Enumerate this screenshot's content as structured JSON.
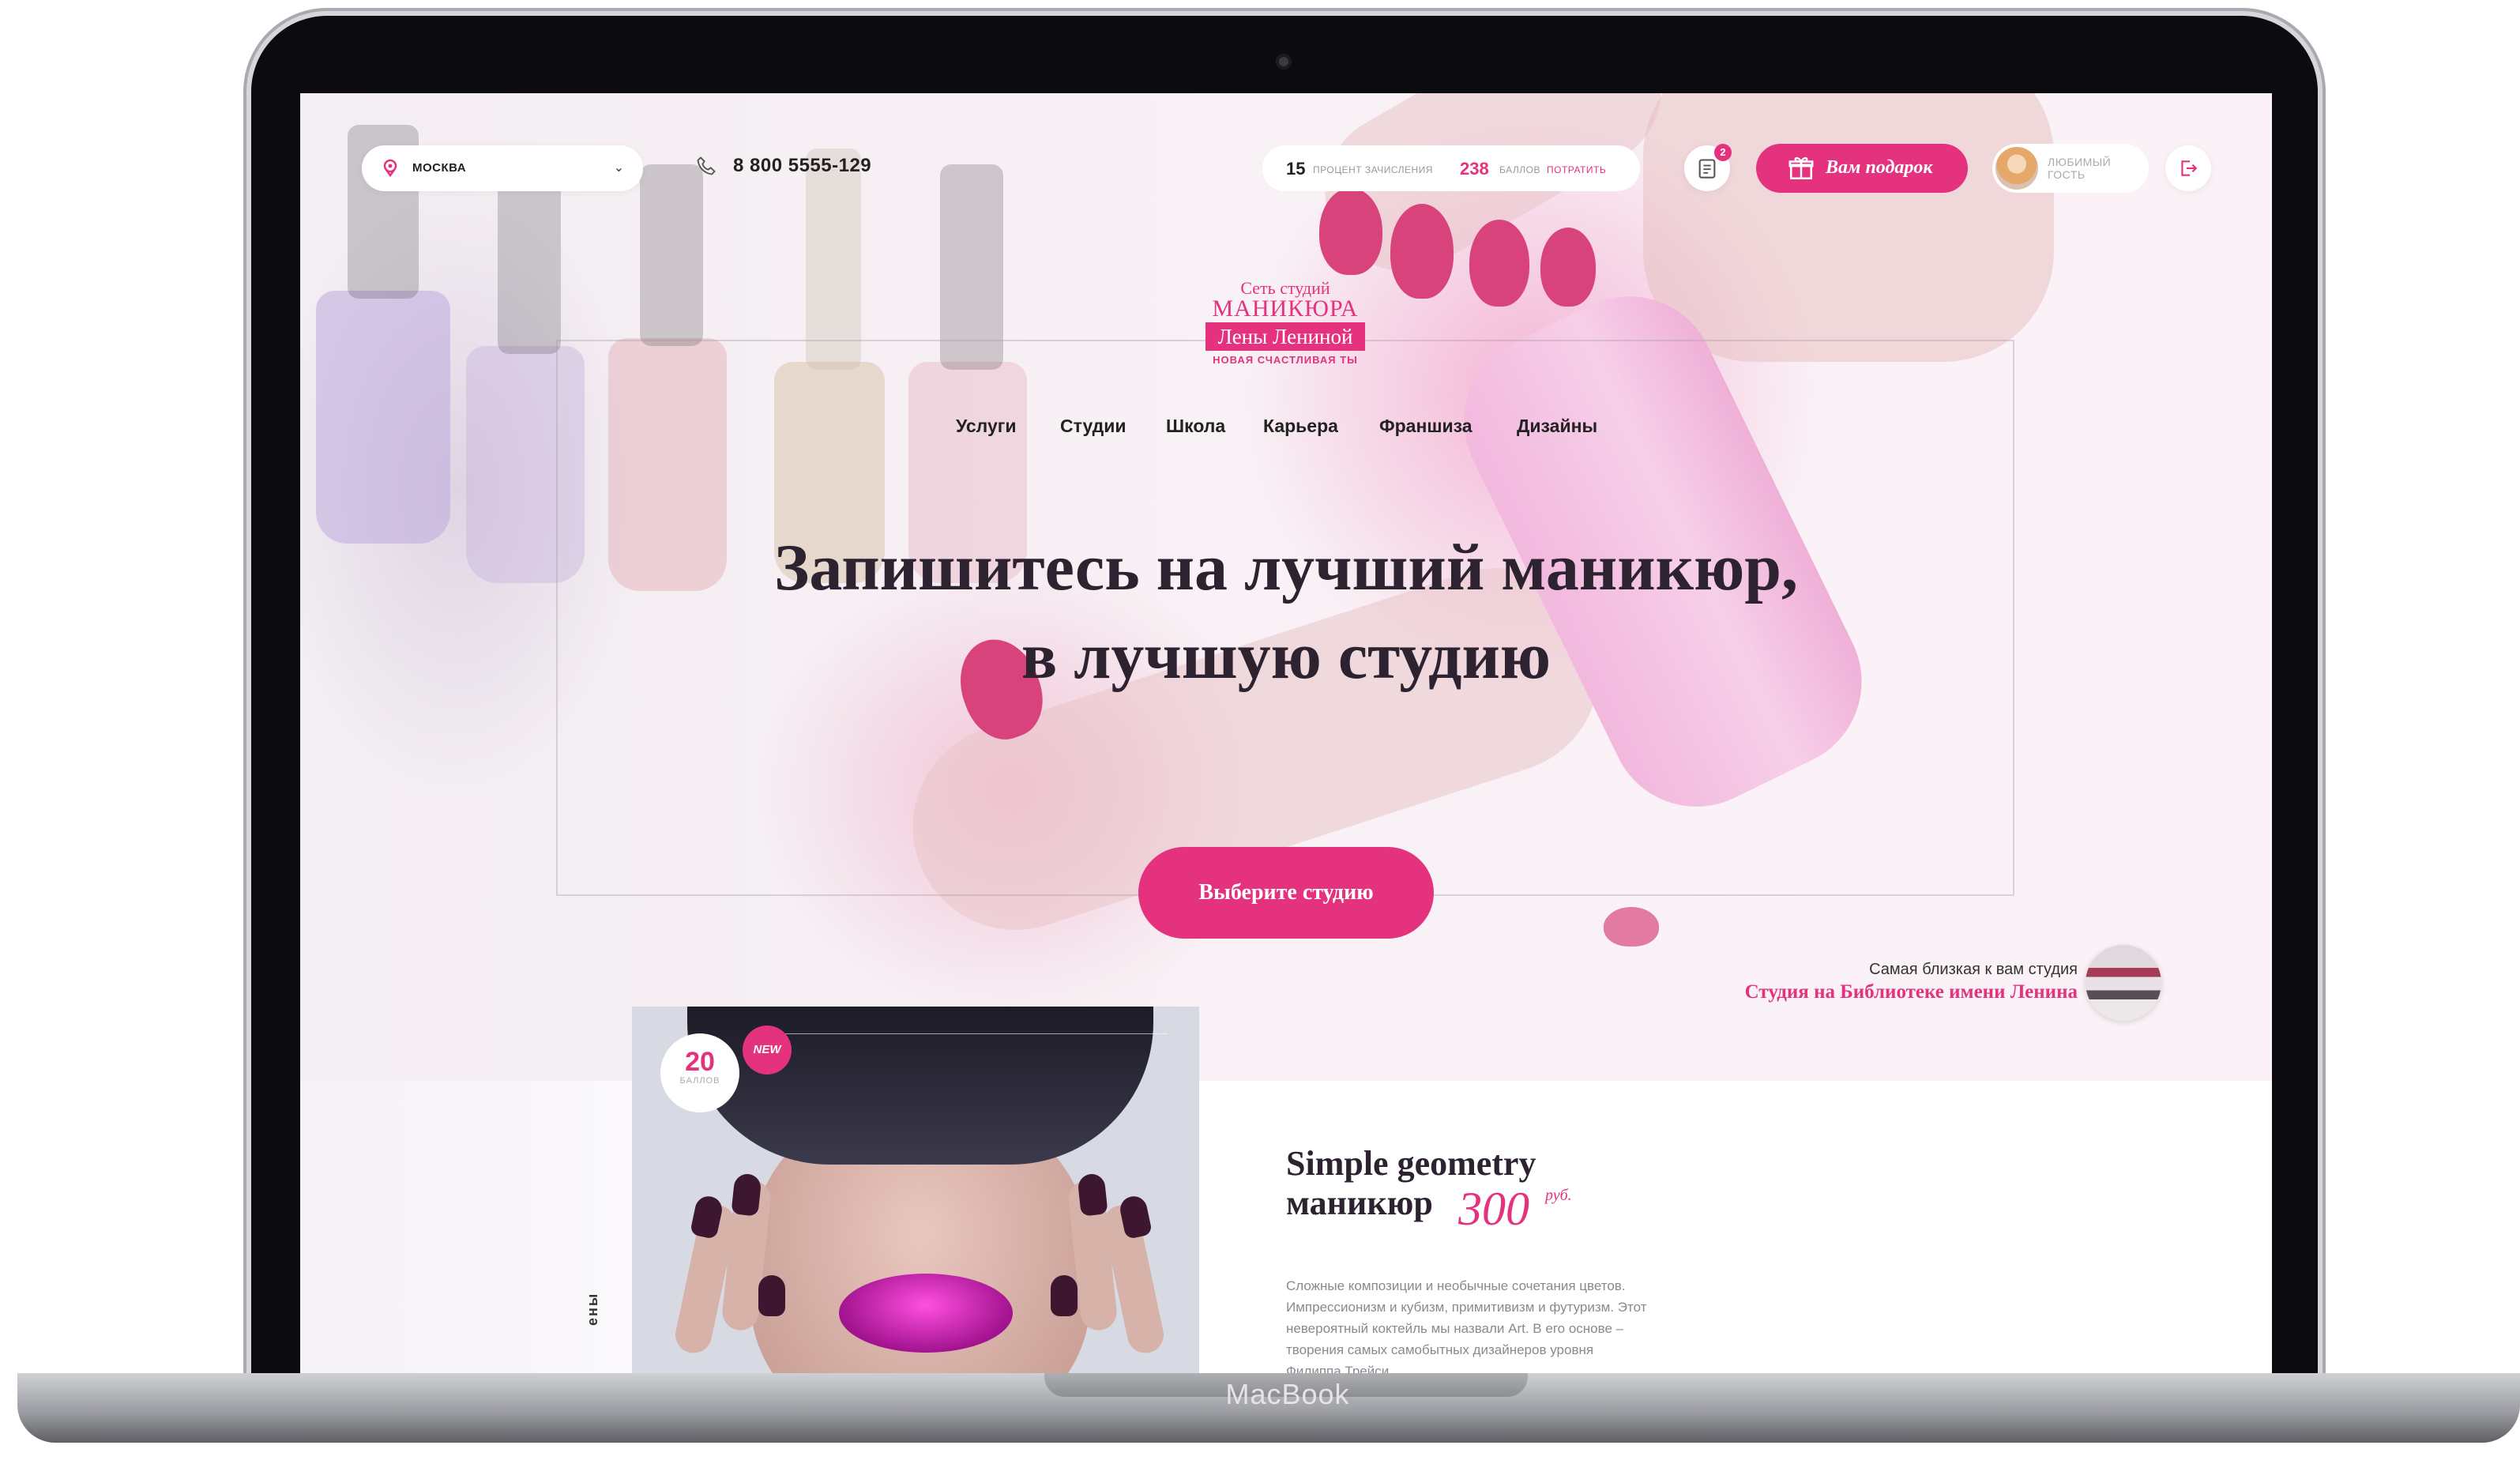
{
  "device": {
    "brand": "MacBook"
  },
  "header": {
    "city": "москва",
    "phone": "8 800 5555-129",
    "points": {
      "percent_value": "15",
      "percent_label": "процент зачисления",
      "balance_value": "238",
      "balance_label": "баллов",
      "spend_link": "потратить"
    },
    "orders_badge": "2",
    "gift_button": "Вам подарок",
    "user": {
      "line1": "Любимый",
      "line2": "гость"
    }
  },
  "logo": {
    "line1": "Сеть студий",
    "line2": "маникюра",
    "line3": "Лены Лениной",
    "tagline": "новая счастливая ты"
  },
  "nav": [
    "Услуги",
    "Студии",
    "Школа",
    "Карьера",
    "Франшиза",
    "Дизайны"
  ],
  "hero": {
    "headline_line1": "Запишитесь на лучший маникюр,",
    "headline_line2": "в лучшую студию",
    "cta": "Выберите студию",
    "nearest_label": "Самая близкая к вам студия",
    "nearest_name": "Студия на Библиотеке имени Ленина"
  },
  "product": {
    "points_value": "20",
    "points_label": "баллов",
    "new_badge": "NEW",
    "vertical_label": "ены",
    "title_line1": "Simple geometry",
    "title_line2": "маникюр",
    "price": "300",
    "currency": "руб.",
    "description": "Сложные композиции и необычные сочетания цветов. Импрессионизм и кубизм, примитивизм и футуризм. Этот невероятный коктейль мы назвали Art. В его основе – творения самых самобытных дизайнеров уровня Филиппа Трейси"
  },
  "colors": {
    "accent": "#e4327f",
    "text": "#2c2230"
  },
  "icons": [
    "location-pin-icon",
    "chevron-down-icon",
    "phone-icon",
    "orders-icon",
    "gift-icon",
    "logout-icon",
    "camera-icon"
  ]
}
